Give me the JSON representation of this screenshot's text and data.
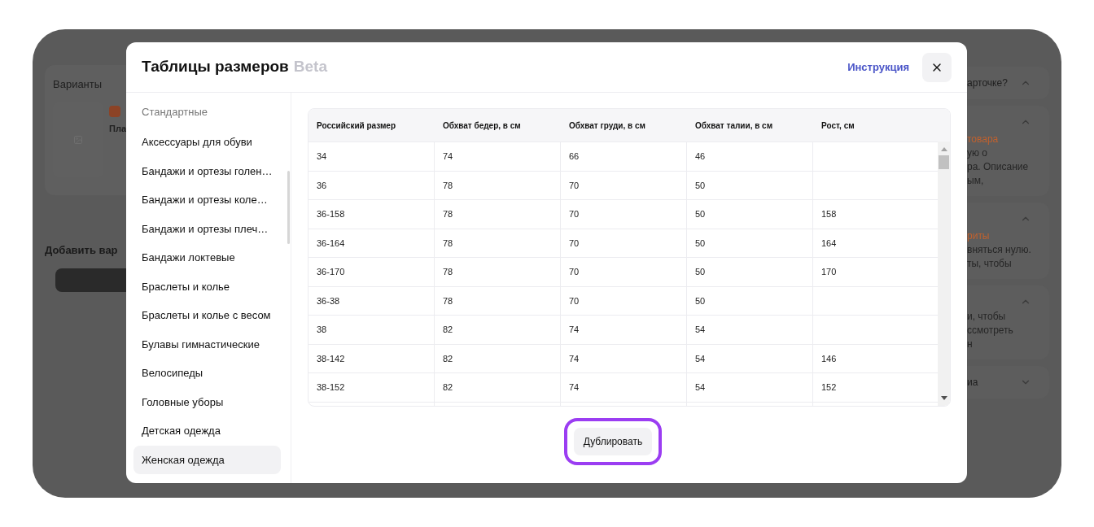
{
  "background": {
    "left": {
      "section_title": "Варианты",
      "variant_name": "Пла",
      "add_title": "Добавить вар"
    },
    "right": [
      {
        "title": "арточке?",
        "expanded": true
      },
      {
        "expanded": true,
        "accent": "товара",
        "lines": [
          "ую о",
          "ра. Описание",
          "ым,"
        ]
      },
      {
        "expanded": true,
        "accent": "риты",
        "lines": [
          "вняться нулю.",
          "ты, чтобы"
        ]
      },
      {
        "expanded": true,
        "lines": [
          "и, чтобы",
          "ссмотреть",
          "н"
        ]
      },
      {
        "title": "иа",
        "expanded": false
      }
    ]
  },
  "modal": {
    "title": "Таблицы размеров",
    "title_badge": "Beta",
    "help_link": "Инструкция",
    "sidebar": {
      "heading": "Стандартные",
      "items": [
        {
          "label": "Аксессуары для обуви",
          "selected": false
        },
        {
          "label": "Бандажи и ортезы голен…",
          "selected": false
        },
        {
          "label": "Бандажи и ортезы коле…",
          "selected": false
        },
        {
          "label": "Бандажи и ортезы плеч…",
          "selected": false
        },
        {
          "label": "Бандажи локтевые",
          "selected": false
        },
        {
          "label": "Браслеты и колье",
          "selected": false
        },
        {
          "label": "Браслеты и колье с весом",
          "selected": false
        },
        {
          "label": "Булавы гимнастические",
          "selected": false
        },
        {
          "label": "Велосипеды",
          "selected": false
        },
        {
          "label": "Головные уборы",
          "selected": false
        },
        {
          "label": "Детская одежда",
          "selected": false
        },
        {
          "label": "Женская одежда",
          "selected": true
        }
      ]
    },
    "table": {
      "columns": [
        "Российский размер",
        "Обхват бедер, в см",
        "Обхват груди, в см",
        "Обхват талии, в см",
        "Рост, см"
      ],
      "rows": [
        [
          "34",
          "74",
          "66",
          "46",
          null
        ],
        [
          "36",
          "78",
          "70",
          "50",
          null
        ],
        [
          "36-158",
          "78",
          "70",
          "50",
          "158"
        ],
        [
          "36-164",
          "78",
          "70",
          "50",
          "164"
        ],
        [
          "36-170",
          "78",
          "70",
          "50",
          "170"
        ],
        [
          "36-38",
          "78",
          "70",
          "50",
          null
        ],
        [
          "38",
          "82",
          "74",
          "54",
          null
        ],
        [
          "38-142",
          "82",
          "74",
          "54",
          "146"
        ],
        [
          "38-152",
          "82",
          "74",
          "54",
          "152"
        ]
      ]
    },
    "action": {
      "label": "Дублировать",
      "highlighted": true
    }
  }
}
